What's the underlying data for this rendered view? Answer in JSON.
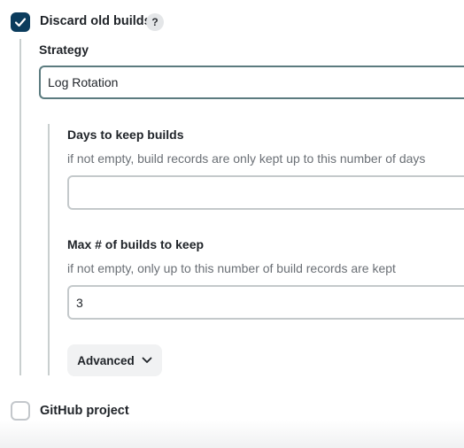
{
  "discard": {
    "label": "Discard old builds",
    "checked": true,
    "help": "?"
  },
  "strategy": {
    "label": "Strategy",
    "value": "Log Rotation"
  },
  "days_to_keep": {
    "label": "Days to keep builds",
    "description": "if not empty, build records are only kept up to this number of days",
    "value": ""
  },
  "max_builds": {
    "label": "Max # of builds to keep",
    "description": "if not empty, only up to this number of build records are kept",
    "value": "3"
  },
  "advanced": {
    "label": "Advanced"
  },
  "github": {
    "label": "GitHub project",
    "checked": false
  },
  "colors": {
    "checkbox_checked": "#0b3c5d",
    "select_border": "#5b7b7f",
    "input_border": "#c4c9cb"
  }
}
